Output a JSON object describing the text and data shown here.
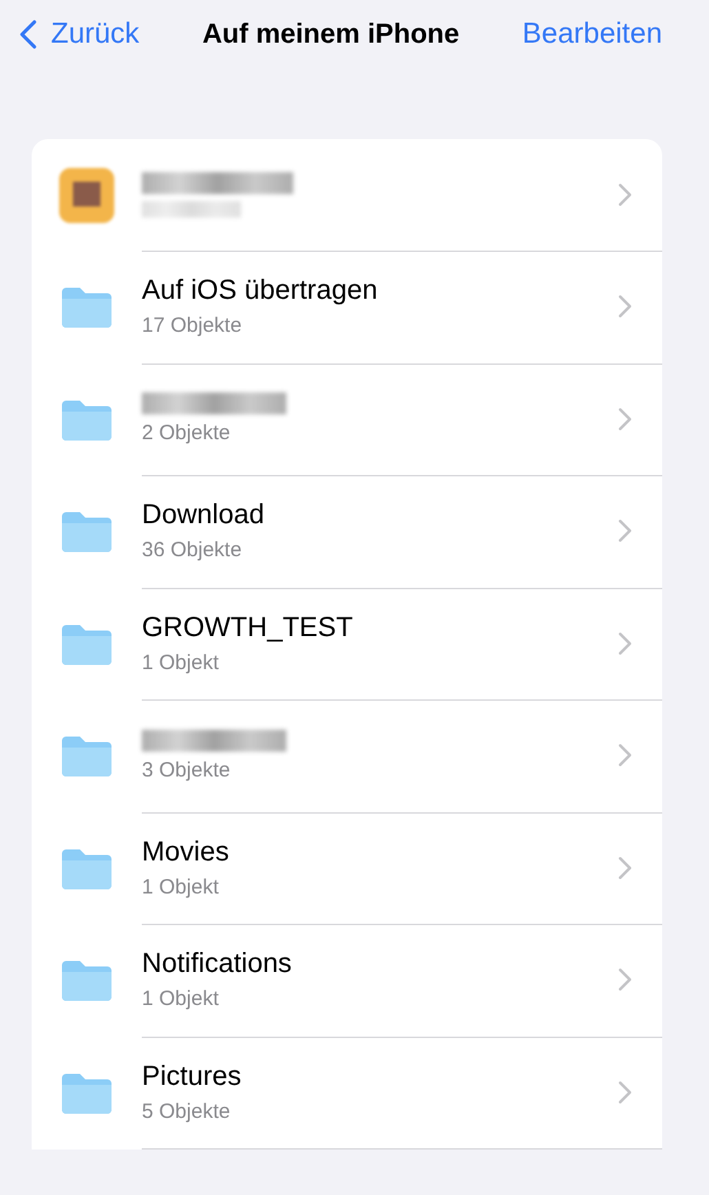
{
  "nav": {
    "back": "Zurück",
    "title": "Auf meinem iPhone",
    "action": "Bearbeiten"
  },
  "items": [
    {
      "kind": "app"
    },
    {
      "kind": "folder",
      "title": "Auf iOS übertragen",
      "subtitle": "17 Objekte"
    },
    {
      "kind": "folder",
      "subtitle": "2 Objekte"
    },
    {
      "kind": "folder",
      "title": "Download",
      "subtitle": "36 Objekte"
    },
    {
      "kind": "folder",
      "title": "GROWTH_TEST",
      "subtitle": "1 Objekt"
    },
    {
      "kind": "folder",
      "subtitle": "3 Objekte"
    },
    {
      "kind": "folder",
      "title": "Movies",
      "subtitle": "1 Objekt"
    },
    {
      "kind": "folder",
      "title": "Notifications",
      "subtitle": "1 Objekt"
    },
    {
      "kind": "folder",
      "title": "Pictures",
      "subtitle": "5 Objekte"
    }
  ]
}
